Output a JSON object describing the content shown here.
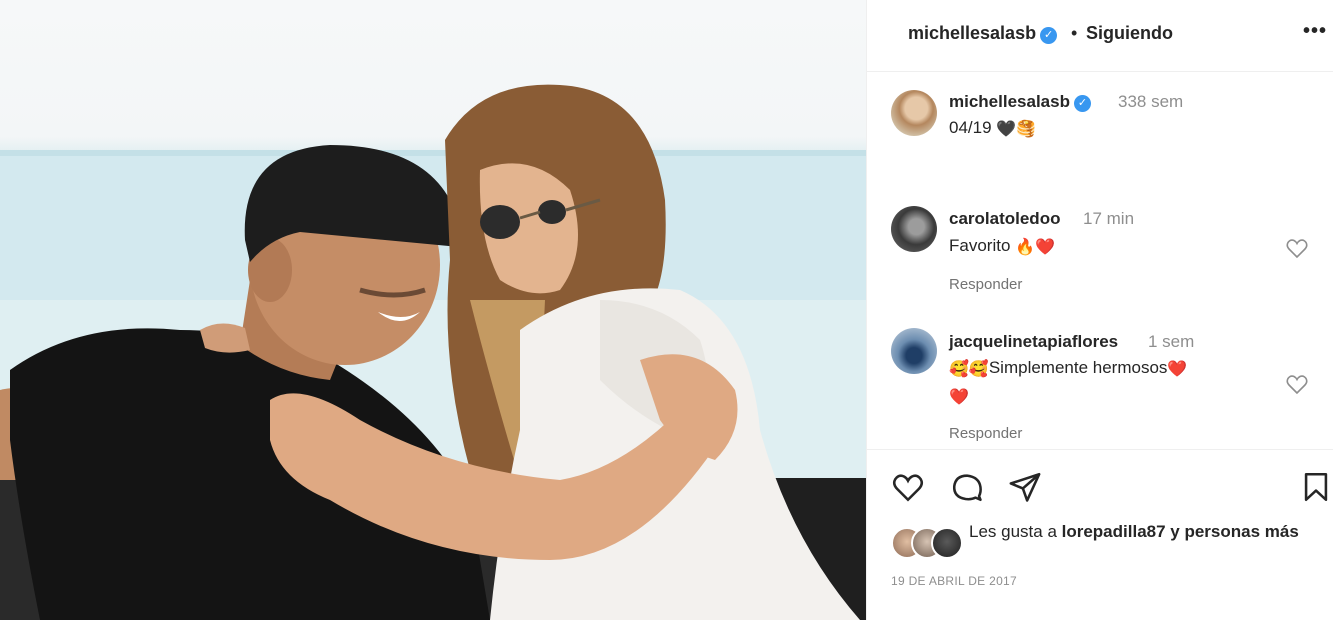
{
  "post": {
    "photo_alt": "",
    "header": {
      "username": "michellesalasb",
      "verified_mark": "✓",
      "separator": "•",
      "follow_state": "Siguiendo",
      "more_label": "•••"
    },
    "caption": {
      "username": "michellesalasb",
      "time": "338 sem",
      "text": "04/19",
      "emojis": "🖤🥞"
    },
    "comments": [
      {
        "username": "carolatoledoo",
        "time": "17 min",
        "text": "Favorito",
        "emojis": "🔥❤️",
        "reply_label": "Responder",
        "like_icon": "heart-outline-icon"
      },
      {
        "username": "jacquelinetapiaflores",
        "time": "1 sem",
        "emoji_prefix": "🥰🥰",
        "text": "Simplemente hermosos",
        "emojis": "❤️",
        "emoji_line2": "❤️",
        "reply_label": "Responder",
        "like_icon": "heart-outline-icon"
      }
    ],
    "actions": {
      "icons": [
        "heart-outline-icon",
        "comment-bubble-icon",
        "share-paper-plane-icon",
        "bookmark-icon"
      ]
    },
    "likes": {
      "prefix": "Les gusta a ",
      "user": "lorepadilla87",
      "suffix": " y personas más"
    },
    "date": "19 DE ABRIL DE 2017"
  },
  "colors": {
    "text": "#262626",
    "secondary": "#8e8e8e",
    "verified": "#3897f0",
    "divider": "#efefef"
  }
}
